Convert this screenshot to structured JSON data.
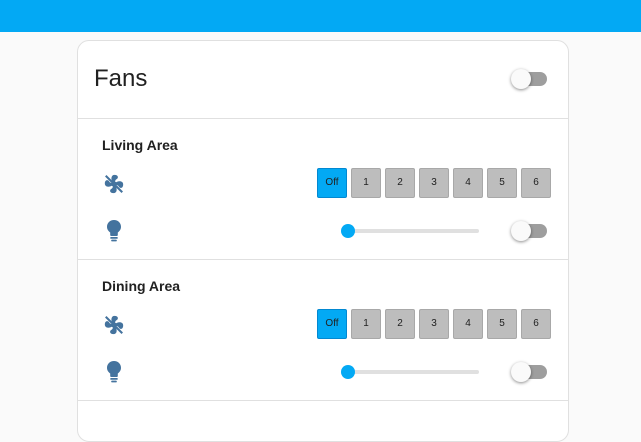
{
  "card": {
    "title": "Fans",
    "master_toggle": {
      "on": false
    }
  },
  "sections": [
    {
      "title": "Living Area",
      "fan_icon": "fan-off-icon",
      "light_icon": "lightbulb-icon",
      "speeds": [
        "Off",
        "1",
        "2",
        "3",
        "4",
        "5",
        "6"
      ],
      "active_speed": "Off",
      "brightness": 0,
      "light_on": false
    },
    {
      "title": "Dining Area",
      "fan_icon": "fan-off-icon",
      "light_icon": "lightbulb-icon",
      "speeds": [
        "Off",
        "1",
        "2",
        "3",
        "4",
        "5",
        "6"
      ],
      "active_speed": "Off",
      "brightness": 0,
      "light_on": false
    }
  ],
  "colors": {
    "accent": "#03a9f4",
    "icon": "#44739e",
    "button_inactive": "#bdbdbd",
    "toggle_off": "#9e9e9e"
  }
}
